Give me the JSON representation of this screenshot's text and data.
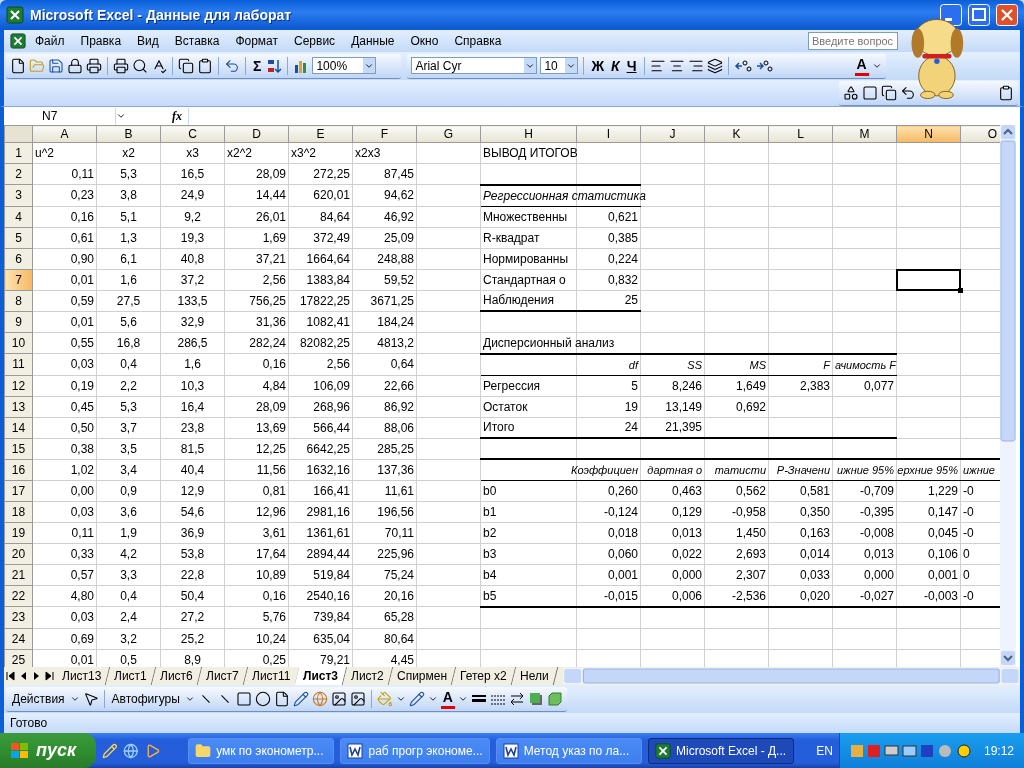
{
  "window": {
    "title": "Microsoft Excel - Данные для лаборат"
  },
  "menu": [
    "Файл",
    "Правка",
    "Вид",
    "Вставка",
    "Формат",
    "Сервис",
    "Данные",
    "Окно",
    "Справка"
  ],
  "help_box": {
    "placeholder": "Введите вопрос"
  },
  "toolbar": {
    "sum": "Σ",
    "zoom": "100%",
    "font": "Arial Cyr",
    "font_size": "10",
    "bold": "Ж",
    "italic": "К",
    "underline": "Ч",
    "font_color": "A"
  },
  "formula_bar": {
    "name_box": "N7",
    "fx": "fx"
  },
  "sheet": {
    "columns": [
      {
        "label": "A",
        "selected": false
      },
      {
        "label": "B",
        "selected": false
      },
      {
        "label": "C",
        "selected": false
      },
      {
        "label": "D",
        "selected": false
      },
      {
        "label": "E",
        "selected": false
      },
      {
        "label": "F",
        "selected": false
      },
      {
        "label": "G",
        "selected": false
      },
      {
        "label": "H",
        "selected": false
      },
      {
        "label": "I",
        "selected": false
      },
      {
        "label": "J",
        "selected": false
      },
      {
        "label": "K",
        "selected": false
      },
      {
        "label": "L",
        "selected": false
      },
      {
        "label": "M",
        "selected": false
      },
      {
        "label": "N",
        "selected": true
      },
      {
        "label": "O",
        "selected": false
      }
    ],
    "rows": [
      {
        "label": "1",
        "selected": false,
        "cells": [
          {
            "text": "u^2",
            "kind": "text"
          },
          {
            "text": "x2",
            "kind": "centered"
          },
          {
            "text": "x3",
            "kind": "centered"
          },
          {
            "text": "x2^2",
            "kind": "text"
          },
          {
            "text": "x3^2",
            "kind": "text"
          },
          {
            "text": "x2x3",
            "kind": "text"
          },
          null,
          {
            "text": "ВЫВОД ИТОГОВ",
            "kind": "text"
          }
        ]
      },
      {
        "label": "2",
        "selected": false,
        "cells": [
          {
            "text": "0,11",
            "kind": "number"
          },
          {
            "text": "5,3",
            "kind": "centered"
          },
          {
            "text": "16,5",
            "kind": "centered"
          },
          {
            "text": "28,09",
            "kind": "number"
          },
          {
            "text": "272,25",
            "kind": "number"
          },
          {
            "text": "87,45",
            "kind": "number"
          },
          null,
          {
            "thick_rule": true
          },
          {
            "thick_rule": true
          }
        ]
      },
      {
        "label": "3",
        "selected": false,
        "cells": [
          {
            "text": "0,23",
            "kind": "number"
          },
          {
            "text": "3,8",
            "kind": "centered"
          },
          {
            "text": "24,9",
            "kind": "centered"
          },
          {
            "text": "14,44",
            "kind": "number"
          },
          {
            "text": "620,01",
            "kind": "number"
          },
          {
            "text": "94,62",
            "kind": "number"
          },
          null,
          {
            "text": "Регрессионная статистика",
            "kind": "title",
            "thin_rule": true
          },
          {
            "thin_rule": true
          }
        ]
      },
      {
        "label": "4",
        "selected": false,
        "cells": [
          {
            "text": "0,16",
            "kind": "number"
          },
          {
            "text": "5,1",
            "kind": "centered"
          },
          {
            "text": "9,2",
            "kind": "centered"
          },
          {
            "text": "26,01",
            "kind": "number"
          },
          {
            "text": "84,64",
            "kind": "number"
          },
          {
            "text": "46,92",
            "kind": "number"
          },
          null,
          {
            "text": "Множественны",
            "kind": "text"
          },
          {
            "text": "0,621",
            "kind": "number"
          }
        ]
      },
      {
        "label": "5",
        "selected": false,
        "cells": [
          {
            "text": "0,61",
            "kind": "number"
          },
          {
            "text": "1,3",
            "kind": "centered"
          },
          {
            "text": "19,3",
            "kind": "centered"
          },
          {
            "text": "1,69",
            "kind": "number"
          },
          {
            "text": "372,49",
            "kind": "number"
          },
          {
            "text": "25,09",
            "kind": "number"
          },
          null,
          {
            "text": "R-квадрат",
            "kind": "text"
          },
          {
            "text": "0,385",
            "kind": "number"
          }
        ]
      },
      {
        "label": "6",
        "selected": false,
        "cells": [
          {
            "text": "0,90",
            "kind": "number"
          },
          {
            "text": "6,1",
            "kind": "centered"
          },
          {
            "text": "40,8",
            "kind": "centered"
          },
          {
            "text": "37,21",
            "kind": "number"
          },
          {
            "text": "1664,64",
            "kind": "number"
          },
          {
            "text": "248,88",
            "kind": "number"
          },
          null,
          {
            "text": "Нормированны",
            "kind": "text"
          },
          {
            "text": "0,224",
            "kind": "number"
          }
        ]
      },
      {
        "label": "7",
        "selected": true,
        "cells": [
          {
            "text": "0,01",
            "kind": "number"
          },
          {
            "text": "1,6",
            "kind": "centered"
          },
          {
            "text": "37,2",
            "kind": "centered"
          },
          {
            "text": "2,56",
            "kind": "number"
          },
          {
            "text": "1383,84",
            "kind": "number"
          },
          {
            "text": "59,52",
            "kind": "number"
          },
          null,
          {
            "text": "Стандартная о",
            "kind": "text"
          },
          {
            "text": "0,832",
            "kind": "number"
          }
        ]
      },
      {
        "label": "8",
        "selected": false,
        "cells": [
          {
            "text": "0,59",
            "kind": "number"
          },
          {
            "text": "27,5",
            "kind": "centered"
          },
          {
            "text": "133,5",
            "kind": "centered"
          },
          {
            "text": "756,25",
            "kind": "number"
          },
          {
            "text": "17822,25",
            "kind": "number"
          },
          {
            "text": "3671,25",
            "kind": "number"
          },
          null,
          {
            "text": "Наблюдения",
            "kind": "text",
            "thick_rule": true
          },
          {
            "text": "25",
            "kind": "number",
            "thick_rule": true
          }
        ]
      },
      {
        "label": "9",
        "selected": false,
        "cells": [
          {
            "text": "0,01",
            "kind": "number"
          },
          {
            "text": "5,6",
            "kind": "centered"
          },
          {
            "text": "32,9",
            "kind": "centered"
          },
          {
            "text": "31,36",
            "kind": "number"
          },
          {
            "text": "1082,41",
            "kind": "number"
          },
          {
            "text": "184,24",
            "kind": "number"
          }
        ]
      },
      {
        "label": "10",
        "selected": false,
        "cells": [
          {
            "text": "0,55",
            "kind": "number"
          },
          {
            "text": "16,8",
            "kind": "centered"
          },
          {
            "text": "286,5",
            "kind": "centered"
          },
          {
            "text": "282,24",
            "kind": "number"
          },
          {
            "text": "82082,25",
            "kind": "number"
          },
          {
            "text": "4813,2",
            "kind": "number"
          },
          null,
          {
            "text": "Дисперсионный анализ",
            "kind": "text",
            "thick_rule": true
          },
          {
            "thick_rule": true
          },
          {
            "thick_rule": true
          },
          {
            "thick_rule": true
          },
          {
            "thick_rule": true
          },
          {
            "thick_rule": true
          }
        ]
      },
      {
        "label": "11",
        "selected": false,
        "cells": [
          {
            "text": "0,03",
            "kind": "number"
          },
          {
            "text": "0,4",
            "kind": "centered"
          },
          {
            "text": "1,6",
            "kind": "centered"
          },
          {
            "text": "0,16",
            "kind": "number"
          },
          {
            "text": "2,56",
            "kind": "number"
          },
          {
            "text": "0,64",
            "kind": "number"
          },
          null,
          {
            "thin_rule": true
          },
          {
            "text": "df",
            "kind": "heading",
            "thin_rule": true
          },
          {
            "text": "SS",
            "kind": "heading",
            "thin_rule": true
          },
          {
            "text": "MS",
            "kind": "heading",
            "thin_rule": true
          },
          {
            "text": "F",
            "kind": "heading",
            "thin_rule": true
          },
          {
            "text": "ачимость F",
            "kind": "caption",
            "thin_rule": true
          }
        ]
      },
      {
        "label": "12",
        "selected": false,
        "cells": [
          {
            "text": "0,19",
            "kind": "number"
          },
          {
            "text": "2,2",
            "kind": "centered"
          },
          {
            "text": "10,3",
            "kind": "centered"
          },
          {
            "text": "4,84",
            "kind": "number"
          },
          {
            "text": "106,09",
            "kind": "number"
          },
          {
            "text": "22,66",
            "kind": "number"
          },
          null,
          {
            "text": "Регрессия",
            "kind": "text"
          },
          {
            "text": "5",
            "kind": "number"
          },
          {
            "text": "8,246",
            "kind": "number"
          },
          {
            "text": "1,649",
            "kind": "number"
          },
          {
            "text": "2,383",
            "kind": "number"
          },
          {
            "text": "0,077",
            "kind": "number"
          }
        ]
      },
      {
        "label": "13",
        "selected": false,
        "cells": [
          {
            "text": "0,45",
            "kind": "number"
          },
          {
            "text": "5,3",
            "kind": "centered"
          },
          {
            "text": "16,4",
            "kind": "centered"
          },
          {
            "text": "28,09",
            "kind": "number"
          },
          {
            "text": "268,96",
            "kind": "number"
          },
          {
            "text": "86,92",
            "kind": "number"
          },
          null,
          {
            "text": "Остаток",
            "kind": "text"
          },
          {
            "text": "19",
            "kind": "number"
          },
          {
            "text": "13,149",
            "kind": "number"
          },
          {
            "text": "0,692",
            "kind": "number"
          }
        ]
      },
      {
        "label": "14",
        "selected": false,
        "cells": [
          {
            "text": "0,50",
            "kind": "number"
          },
          {
            "text": "3,7",
            "kind": "centered"
          },
          {
            "text": "23,8",
            "kind": "centered"
          },
          {
            "text": "13,69",
            "kind": "number"
          },
          {
            "text": "566,44",
            "kind": "number"
          },
          {
            "text": "88,06",
            "kind": "number"
          },
          null,
          {
            "text": "Итого",
            "kind": "text",
            "thick_rule": true
          },
          {
            "text": "24",
            "kind": "number",
            "thick_rule": true
          },
          {
            "text": "21,395",
            "kind": "number",
            "thick_rule": true
          },
          {
            "thick_rule": true
          },
          {
            "thick_rule": true
          },
          {
            "thick_rule": true
          }
        ]
      },
      {
        "label": "15",
        "selected": false,
        "cells": [
          {
            "text": "0,38",
            "kind": "number"
          },
          {
            "text": "3,5",
            "kind": "centered"
          },
          {
            "text": "81,5",
            "kind": "centered"
          },
          {
            "text": "12,25",
            "kind": "number"
          },
          {
            "text": "6642,25",
            "kind": "number"
          },
          {
            "text": "285,25",
            "kind": "number"
          },
          null,
          {
            "thick_rule": true
          },
          {
            "thick_rule": true
          },
          {
            "thick_rule": true
          },
          {
            "thick_rule": true
          },
          {
            "thick_rule": true
          },
          {
            "thick_rule": true
          },
          {
            "thick_rule": true
          },
          {
            "thick_rule": true
          }
        ]
      },
      {
        "label": "16",
        "selected": false,
        "cells": [
          {
            "text": "1,02",
            "kind": "number"
          },
          {
            "text": "3,4",
            "kind": "centered"
          },
          {
            "text": "40,4",
            "kind": "centered"
          },
          {
            "text": "11,56",
            "kind": "number"
          },
          {
            "text": "1632,16",
            "kind": "number"
          },
          {
            "text": "137,36",
            "kind": "number"
          },
          null,
          {
            "thin_rule": true
          },
          {
            "text": "Коэффициен",
            "kind": "heading",
            "thin_rule": true
          },
          {
            "text": "дартная о",
            "kind": "heading",
            "thin_rule": true
          },
          {
            "text": "татисти",
            "kind": "heading",
            "thin_rule": true
          },
          {
            "text": "P-Значени",
            "kind": "heading",
            "thin_rule": true
          },
          {
            "text": "ижние 95%",
            "kind": "heading",
            "thin_rule": true
          },
          {
            "text": "ерхние 95%",
            "kind": "heading",
            "thin_rule": true
          },
          {
            "text": "ижние",
            "kind": "caption",
            "thin_rule": true
          }
        ]
      },
      {
        "label": "17",
        "selected": false,
        "cells": [
          {
            "text": "0,00",
            "kind": "number"
          },
          {
            "text": "0,9",
            "kind": "centered"
          },
          {
            "text": "12,9",
            "kind": "centered"
          },
          {
            "text": "0,81",
            "kind": "number"
          },
          {
            "text": "166,41",
            "kind": "number"
          },
          {
            "text": "11,61",
            "kind": "number"
          },
          null,
          {
            "text": "b0",
            "kind": "text"
          },
          {
            "text": "0,260",
            "kind": "number"
          },
          {
            "text": "0,463",
            "kind": "number"
          },
          {
            "text": "0,562",
            "kind": "number"
          },
          {
            "text": "0,581",
            "kind": "number"
          },
          {
            "text": "-0,709",
            "kind": "number"
          },
          {
            "text": "1,229",
            "kind": "number"
          },
          {
            "text": "-0",
            "kind": "text"
          }
        ]
      },
      {
        "label": "18",
        "selected": false,
        "cells": [
          {
            "text": "0,03",
            "kind": "number"
          },
          {
            "text": "3,6",
            "kind": "centered"
          },
          {
            "text": "54,6",
            "kind": "centered"
          },
          {
            "text": "12,96",
            "kind": "number"
          },
          {
            "text": "2981,16",
            "kind": "number"
          },
          {
            "text": "196,56",
            "kind": "number"
          },
          null,
          {
            "text": "b1",
            "kind": "text"
          },
          {
            "text": "-0,124",
            "kind": "number"
          },
          {
            "text": "0,129",
            "kind": "number"
          },
          {
            "text": "-0,958",
            "kind": "number"
          },
          {
            "text": "0,350",
            "kind": "number"
          },
          {
            "text": "-0,395",
            "kind": "number"
          },
          {
            "text": "0,147",
            "kind": "number"
          },
          {
            "text": "-0",
            "kind": "text"
          }
        ]
      },
      {
        "label": "19",
        "selected": false,
        "cells": [
          {
            "text": "0,11",
            "kind": "number"
          },
          {
            "text": "1,9",
            "kind": "centered"
          },
          {
            "text": "36,9",
            "kind": "centered"
          },
          {
            "text": "3,61",
            "kind": "number"
          },
          {
            "text": "1361,61",
            "kind": "number"
          },
          {
            "text": "70,11",
            "kind": "number"
          },
          null,
          {
            "text": "b2",
            "kind": "text"
          },
          {
            "text": "0,018",
            "kind": "number"
          },
          {
            "text": "0,013",
            "kind": "number"
          },
          {
            "text": "1,450",
            "kind": "number"
          },
          {
            "text": "0,163",
            "kind": "number"
          },
          {
            "text": "-0,008",
            "kind": "number"
          },
          {
            "text": "0,045",
            "kind": "number"
          },
          {
            "text": "-0",
            "kind": "text"
          }
        ]
      },
      {
        "label": "20",
        "selected": false,
        "cells": [
          {
            "text": "0,33",
            "kind": "number"
          },
          {
            "text": "4,2",
            "kind": "centered"
          },
          {
            "text": "53,8",
            "kind": "centered"
          },
          {
            "text": "17,64",
            "kind": "number"
          },
          {
            "text": "2894,44",
            "kind": "number"
          },
          {
            "text": "225,96",
            "kind": "number"
          },
          null,
          {
            "text": "b3",
            "kind": "text"
          },
          {
            "text": "0,060",
            "kind": "number"
          },
          {
            "text": "0,022",
            "kind": "number"
          },
          {
            "text": "2,693",
            "kind": "number"
          },
          {
            "text": "0,014",
            "kind": "number"
          },
          {
            "text": "0,013",
            "kind": "number"
          },
          {
            "text": "0,106",
            "kind": "number"
          },
          {
            "text": "0",
            "kind": "text"
          }
        ]
      },
      {
        "label": "21",
        "selected": false,
        "cells": [
          {
            "text": "0,57",
            "kind": "number"
          },
          {
            "text": "3,3",
            "kind": "centered"
          },
          {
            "text": "22,8",
            "kind": "centered"
          },
          {
            "text": "10,89",
            "kind": "number"
          },
          {
            "text": "519,84",
            "kind": "number"
          },
          {
            "text": "75,24",
            "kind": "number"
          },
          null,
          {
            "text": "b4",
            "kind": "text"
          },
          {
            "text": "0,001",
            "kind": "number"
          },
          {
            "text": "0,000",
            "kind": "number"
          },
          {
            "text": "2,307",
            "kind": "number"
          },
          {
            "text": "0,033",
            "kind": "number"
          },
          {
            "text": "0,000",
            "kind": "number"
          },
          {
            "text": "0,001",
            "kind": "number"
          },
          {
            "text": "0",
            "kind": "text"
          }
        ]
      },
      {
        "label": "22",
        "selected": false,
        "cells": [
          {
            "text": "4,80",
            "kind": "number"
          },
          {
            "text": "0,4",
            "kind": "centered"
          },
          {
            "text": "50,4",
            "kind": "centered"
          },
          {
            "text": "0,16",
            "kind": "number"
          },
          {
            "text": "2540,16",
            "kind": "number"
          },
          {
            "text": "20,16",
            "kind": "number"
          },
          null,
          {
            "text": "b5",
            "kind": "text",
            "thick_rule": true
          },
          {
            "text": "-0,015",
            "kind": "number",
            "thick_rule": true
          },
          {
            "text": "0,006",
            "kind": "number",
            "thick_rule": true
          },
          {
            "text": "-2,536",
            "kind": "number",
            "thick_rule": true
          },
          {
            "text": "0,020",
            "kind": "number",
            "thick_rule": true
          },
          {
            "text": "-0,027",
            "kind": "number",
            "thick_rule": true
          },
          {
            "text": "-0,003",
            "kind": "number",
            "thick_rule": true
          },
          {
            "text": "-0",
            "kind": "text",
            "thick_rule": true
          }
        ]
      },
      {
        "label": "23",
        "selected": false,
        "cells": [
          {
            "text": "0,03",
            "kind": "number"
          },
          {
            "text": "2,4",
            "kind": "centered"
          },
          {
            "text": "27,2",
            "kind": "centered"
          },
          {
            "text": "5,76",
            "kind": "number"
          },
          {
            "text": "739,84",
            "kind": "number"
          },
          {
            "text": "65,28",
            "kind": "number"
          }
        ]
      },
      {
        "label": "24",
        "selected": false,
        "cells": [
          {
            "text": "0,69",
            "kind": "number"
          },
          {
            "text": "3,2",
            "kind": "centered"
          },
          {
            "text": "25,2",
            "kind": "centered"
          },
          {
            "text": "10,24",
            "kind": "number"
          },
          {
            "text": "635,04",
            "kind": "number"
          },
          {
            "text": "80,64",
            "kind": "number"
          }
        ]
      },
      {
        "label": "25",
        "selected": false,
        "cells": [
          {
            "text": "0,01",
            "kind": "number"
          },
          {
            "text": "0,5",
            "kind": "centered"
          },
          {
            "text": "8,9",
            "kind": "centered"
          },
          {
            "text": "0,25",
            "kind": "number"
          },
          {
            "text": "79,21",
            "kind": "number"
          },
          {
            "text": "4,45",
            "kind": "number"
          }
        ]
      }
    ]
  },
  "sheet_tabs": [
    {
      "label": "Лист13",
      "selected": false
    },
    {
      "label": "Лист1",
      "selected": false
    },
    {
      "label": "Лист6",
      "selected": false
    },
    {
      "label": "Лист7",
      "selected": false
    },
    {
      "label": "Лист11",
      "selected": false
    },
    {
      "label": "Лист3",
      "selected": true
    },
    {
      "label": "Лист2",
      "selected": false
    },
    {
      "label": "Спирмен",
      "selected": false
    },
    {
      "label": "Гетер x2",
      "selected": false
    },
    {
      "label": "Нели",
      "selected": false
    }
  ],
  "drawing_toolbar": {
    "actions": "Действия",
    "autoshapes": "Автофигуры",
    "font_color": "A"
  },
  "status_bar": {
    "text": "Готово"
  },
  "taskbar": {
    "start": "пуск",
    "tasks": [
      {
        "label": "умк по эконометр...",
        "kind": "folder",
        "selected": false
      },
      {
        "label": "раб прогр экономе...",
        "kind": "word",
        "selected": false
      },
      {
        "label": "Метод указ по ла...",
        "kind": "word",
        "selected": false
      },
      {
        "label": "Microsoft Excel - Д...",
        "kind": "excel",
        "selected": true
      }
    ],
    "language": "EN",
    "clock": "19:12"
  }
}
